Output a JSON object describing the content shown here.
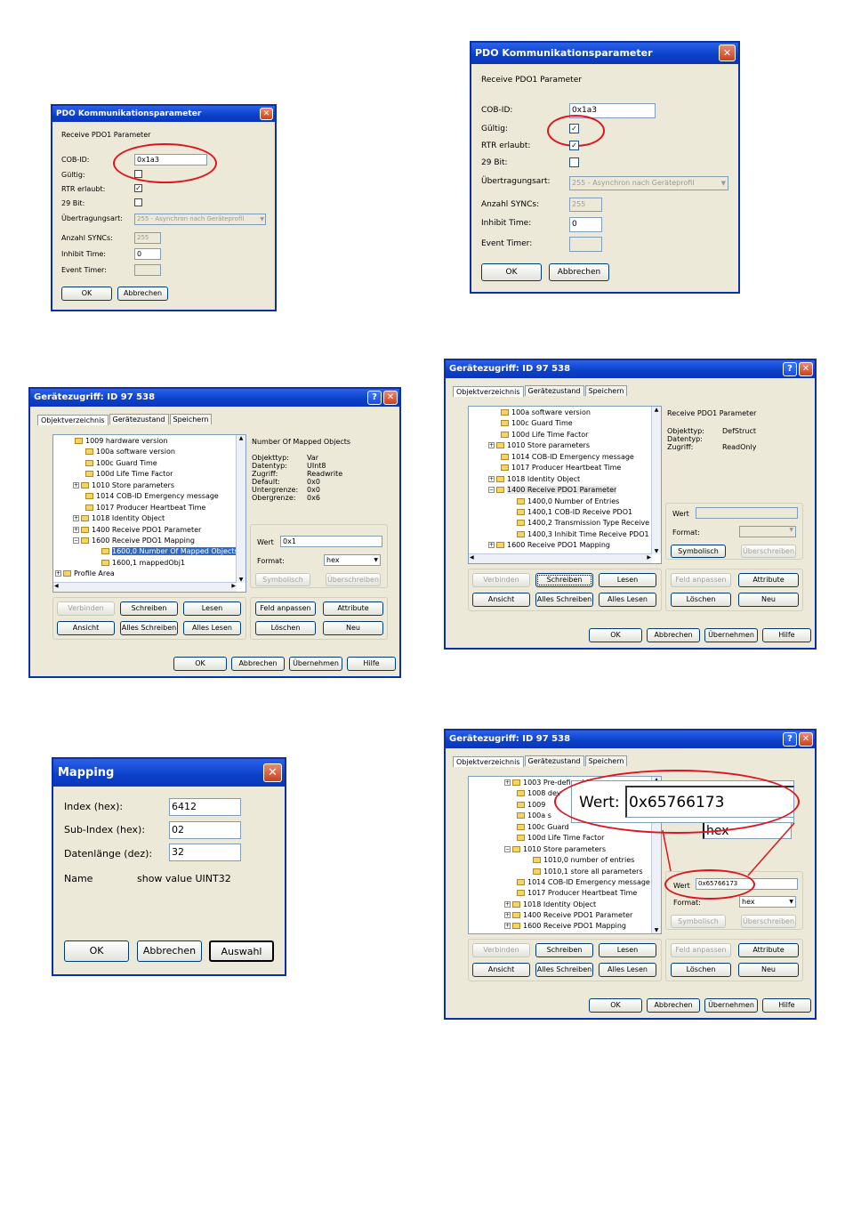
{
  "pdo_small": {
    "title": "PDO Kommunikationsparameter",
    "subtitle": "Receive PDO1 Parameter",
    "cob_label": "COB-ID:",
    "cob_value": "0x1a3",
    "gueltig_label": "Gültig:",
    "rtr_label": "RTR erlaubt:",
    "bit29_label": "29 Bit:",
    "uebertrag_label": "Übertragungsart:",
    "uebertrag_value": "255 - Asynchron nach Geräteprofil",
    "syncs_label": "Anzahl SYNCs:",
    "syncs_value": "255",
    "inhibit_label": "Inhibit Time:",
    "inhibit_value": "0",
    "event_label": "Event Timer:",
    "ok": "OK",
    "cancel": "Abbrechen",
    "rtr_mark": "✓"
  },
  "pdo_large": {
    "title": "PDO Kommunikationsparameter",
    "subtitle": "Receive PDO1 Parameter",
    "cob_label": "COB-ID:",
    "cob_value": "0x1a3",
    "gueltig_label": "Gültig:",
    "gueltig_mark": "✓",
    "rtr_label": "RTR erlaubt:",
    "rtr_mark": "✓",
    "bit29_label": "29 Bit:",
    "uebertrag_label": "Übertragungsart:",
    "uebertrag_value": "255 - Asynchron nach Geräteprofil",
    "syncs_label": "Anzahl SYNCs:",
    "syncs_value": "255",
    "inhibit_label": "Inhibit Time:",
    "inhibit_value": "0",
    "event_label": "Event Timer:",
    "ok": "OK",
    "cancel": "Abbrechen"
  },
  "ga1": {
    "title": "Gerätezugriff: ID 97 538",
    "tabs": [
      "Objektverzeichnis",
      "Gerätezustand",
      "Speichern"
    ],
    "tree": [
      "1009 hardware version",
      "100a software version",
      "100c Guard Time",
      "100d Life Time Factor",
      "1010 Store parameters",
      "1014 COB-ID Emergency message",
      "1017 Producer Heartbeat Time",
      "1018 Identity Object",
      "1400 Receive PDO1 Parameter",
      "1600 Receive PDO1 Mapping",
      "1600,0 Number Of Mapped Objects",
      "1600,1 mappedObj1",
      "Profile Area"
    ],
    "info_title": "Number Of Mapped Objects",
    "info_labels": [
      "Objekttyp:",
      "Datentyp:",
      "Zugriff:",
      "Default:",
      "Untergrenze:",
      "Obergrenze:"
    ],
    "info_values": [
      "Var",
      "UInt8",
      "Readwrite",
      "0x0",
      "0x0",
      "0x6"
    ],
    "wert_label": "Wert",
    "wert_value": "0x1",
    "format_label": "Format:",
    "format_value": "hex",
    "symbolisch": "Symbolisch",
    "ueberschreiben": "Überschreiben",
    "verbinden": "Verbinden",
    "schreiben": "Schreiben",
    "lesen": "Lesen",
    "feld": "Feld anpassen",
    "attribute": "Attribute",
    "ansicht": "Ansicht",
    "alles_schreiben": "Alles Schreiben",
    "alles_lesen": "Alles Lesen",
    "loeschen": "Löschen",
    "neu": "Neu",
    "ok": "OK",
    "abbrechen": "Abbrechen",
    "uebernehmen": "Übernehmen",
    "hilfe": "Hilfe"
  },
  "ga2": {
    "title": "Gerätezugriff: ID 97 538",
    "tabs": [
      "Objektverzeichnis",
      "Gerätezustand",
      "Speichern"
    ],
    "tree": [
      "100a software version",
      "100c Guard Time",
      "100d Life Time Factor",
      "1010 Store parameters",
      "1014 COB-ID Emergency message",
      "1017 Producer Heartbeat Time",
      "1018 Identity Object",
      "1400 Receive PDO1 Parameter",
      "1400,0 Number of Entries",
      "1400,1 COB-ID Receive PDO1",
      "1400,2 Transmission Type Receive",
      "1400,3 Inhibit Time Receive PDO1",
      "1600 Receive PDO1 Mapping"
    ],
    "info_title": "Receive PDO1 Parameter",
    "info_labels": [
      "Objekttyp:",
      "Datentyp:",
      "Zugriff:"
    ],
    "info_values": [
      "DefStruct",
      "",
      "ReadOnly"
    ],
    "wert_label": "Wert",
    "format_label": "Format:",
    "symbolisch": "Symbolisch",
    "ueberschreiben": "Überschreiben",
    "verbinden": "Verbinden",
    "schreiben": "Schreiben",
    "lesen": "Lesen",
    "feld": "Feld anpassen",
    "attribute": "Attribute",
    "ansicht": "Ansicht",
    "alles_schreiben": "Alles Schreiben",
    "alles_lesen": "Alles Lesen",
    "loeschen": "Löschen",
    "neu": "Neu",
    "ok": "OK",
    "abbrechen": "Abbrechen",
    "uebernehmen": "Übernehmen",
    "hilfe": "Hilfe"
  },
  "mapping": {
    "title": "Mapping",
    "index_label": "Index (hex):",
    "index_value": "6412",
    "subindex_label": "Sub-Index (hex):",
    "subindex_value": "02",
    "laenge_label": "Datenlänge (dez):",
    "laenge_value": "32",
    "name_label": "Name",
    "name_value": "show value UINT32",
    "ok": "OK",
    "abbrechen": "Abbrechen",
    "auswahl": "Auswahl"
  },
  "ga3": {
    "title": "Gerätezugriff: ID 97 538",
    "tabs": [
      "Objektverzeichnis",
      "Gerätezustand",
      "Speichern"
    ],
    "tree": [
      "1003 Pre-defined E",
      "1008 dev",
      "1009",
      "100a s",
      "100c Guard",
      "100d Life Time Factor",
      "1010 Store parameters",
      "1010,0 number of entries",
      "1010,1 store all parameters",
      "1014 COB-ID Emergency message",
      "1017 Producer Heartbeat Time",
      "1018 Identity Object",
      "1400 Receive PDO1 Parameter",
      "1600 Receive PDO1 Mapping"
    ],
    "wert_label": "Wert",
    "wert_value": "0x65766173",
    "format_label": "Format:",
    "format_value": "hex",
    "zoom_label": "Wert:",
    "zoom_value": "0x65766173",
    "zoom_partial": "hex",
    "symbolisch": "Symbolisch",
    "ueberschreiben": "Überschreiben",
    "verbinden": "Verbinden",
    "schreiben": "Schreiben",
    "lesen": "Lesen",
    "feld": "Feld anpassen",
    "attribute": "Attribute",
    "ansicht": "Ansicht",
    "alles_schreiben": "Alles Schreiben",
    "alles_lesen": "Alles Lesen",
    "loeschen": "Löschen",
    "neu": "Neu",
    "ok": "OK",
    "abbrechen": "Abbrechen",
    "uebernehmen": "Übernehmen",
    "hilfe": "Hilfe"
  },
  "icons": {
    "close": "✕",
    "help": "?",
    "dropdown": "▼",
    "scroll_up": "▲",
    "scroll_down": "▼",
    "scroll_left": "◀",
    "scroll_right": "▶",
    "expand": "+",
    "collapse": "−"
  },
  "colors": {
    "titlebar": "#0b3fc9",
    "dialog_bg": "#ece9d8",
    "highlight": "#e0141c",
    "selection": "#316ac5"
  }
}
